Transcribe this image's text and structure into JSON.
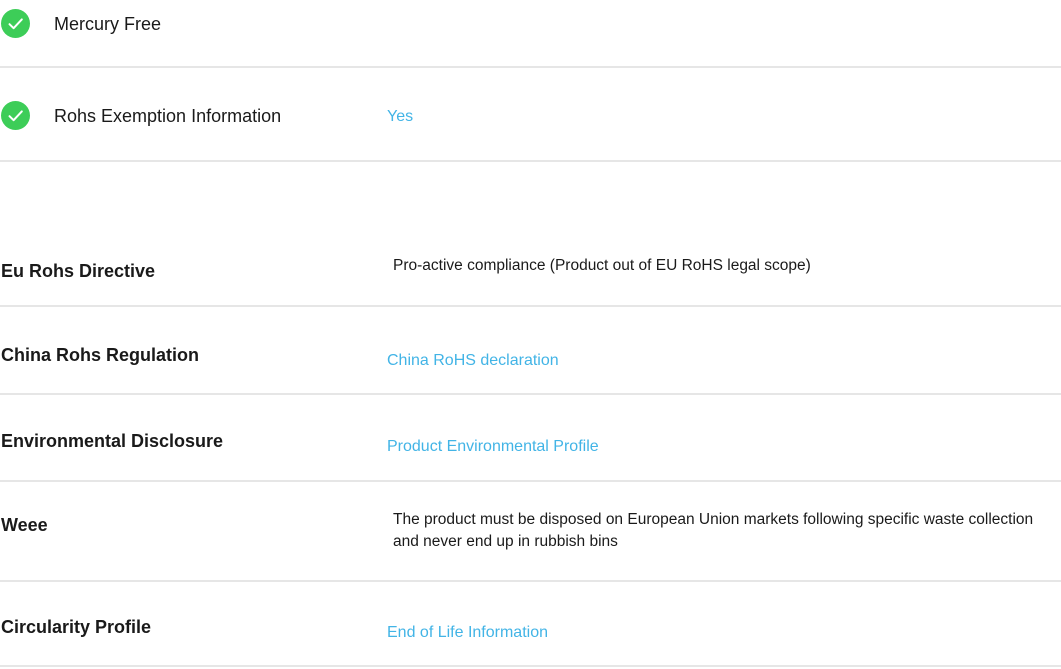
{
  "colors": {
    "check_green": "#3dcd58",
    "link_blue": "#42b4e6",
    "divider_gray": "#e6e6e6",
    "text_dark": "#1a1a1a"
  },
  "checklist": [
    {
      "icon": "check-circle-icon",
      "label": "Mercury Free",
      "value": ""
    },
    {
      "icon": "check-circle-icon",
      "label": "Rohs Exemption Information",
      "value": "Yes"
    }
  ],
  "specs": [
    {
      "label": "Eu Rohs Directive",
      "value": "Pro-active compliance (Product out of EU RoHS legal scope)",
      "is_link": false
    },
    {
      "label": "China Rohs Regulation",
      "value": "China RoHS declaration",
      "is_link": true
    },
    {
      "label": "Environmental Disclosure",
      "value": "Product Environmental Profile",
      "is_link": true
    },
    {
      "label": "Weee",
      "value": "The product must be disposed on European Union markets following specific waste collection and never end up in rubbish bins",
      "is_link": false
    },
    {
      "label": "Circularity Profile",
      "value": "End of Life Information",
      "is_link": true
    }
  ]
}
